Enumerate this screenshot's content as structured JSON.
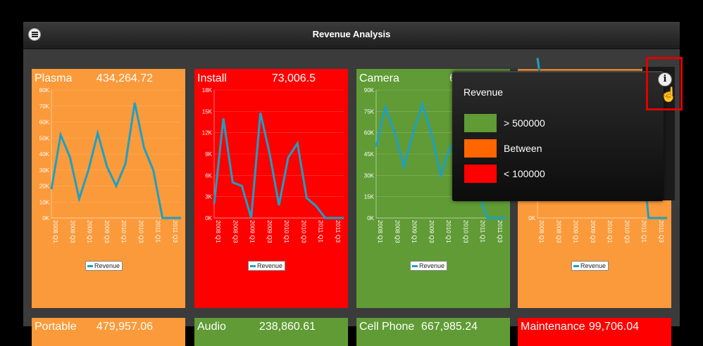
{
  "window": {
    "title": "Revenue Analysis"
  },
  "colors": {
    "green": "#609b35",
    "orange": "#fa9a3a",
    "red": "#fe0000",
    "line": "#1f9fc4",
    "popup_green": "#609b35",
    "popup_orange": "#ff6600",
    "popup_red": "#ff0000"
  },
  "tiles": [
    {
      "name": "Plasma",
      "value": "434,264.72",
      "color": "#fa9a3a",
      "chart_data": {
        "type": "line",
        "series": [
          {
            "name": "Revenue",
            "values": [
              18000,
              52000,
              38000,
              12000,
              30000,
              53000,
              32000,
              20000,
              34000,
              72000,
              44000,
              30000,
              0,
              0,
              0
            ]
          }
        ],
        "yticks": [
          "0K",
          "10K",
          "20K",
          "30K",
          "40K",
          "50K",
          "60K",
          "70K",
          "80K"
        ],
        "ymax": 80000
      }
    },
    {
      "name": "Install",
      "value": "73,006.5",
      "color": "#fe0000",
      "chart_data": {
        "type": "line",
        "series": [
          {
            "name": "Revenue",
            "values": [
              2000,
              14000,
              5000,
              4500,
              0,
              14800,
              9000,
              1800,
              8500,
              10500,
              2800,
              1700,
              0,
              0,
              0
            ]
          }
        ],
        "yticks": [
          "0K",
          "3K",
          "6K",
          "9K",
          "12K",
          "15K",
          "18K"
        ],
        "ymax": 18000
      }
    },
    {
      "name": "Camera",
      "value": "615,7",
      "color": "#609b35",
      "chart_data": {
        "type": "line",
        "series": [
          {
            "name": "Revenue",
            "values": [
              50000,
              78000,
              60000,
              36000,
              60000,
              80000,
              58000,
              30000,
              50000,
              52000,
              36000,
              20000,
              0,
              0,
              0
            ]
          }
        ],
        "yticks": [
          "0K",
          "15K",
          "30K",
          "45K",
          "60K",
          "75K",
          "90K"
        ],
        "ymax": 90000
      }
    },
    {
      "name": "",
      "value": "",
      "color": "#fa9a3a",
      "chart_data": {
        "type": "line",
        "series": [
          {
            "name": "Revenue",
            "values": [
              50000,
              30000,
              8000,
              20000,
              14000,
              18000,
              9000,
              20000,
              18000,
              16000,
              22000,
              30000,
              0,
              0,
              0
            ]
          }
        ],
        "yticks": [
          "0K",
          "10K"
        ],
        "ymax": 40000
      }
    }
  ],
  "xticks": [
    "2008 Q1",
    "2008 Q3",
    "2009 Q1",
    "2009 Q3",
    "2010 Q1",
    "2010 Q3",
    "2011 Q1",
    "2011 Q3"
  ],
  "legend_label": "Revenue",
  "bottom_tiles": [
    {
      "name": "Portable",
      "value": "479,957.06",
      "color": "#fa9a3a"
    },
    {
      "name": "Audio",
      "value": "238,860.61",
      "color": "#609b35"
    },
    {
      "name": "Cell Phone",
      "value": "667,985.24",
      "color": "#609b35"
    },
    {
      "name": "Maintenance",
      "value": "99,706.04",
      "color": "#fe0000"
    }
  ],
  "popup": {
    "title": "Revenue",
    "items": [
      {
        "label": "> 500000",
        "color": "#609b35"
      },
      {
        "label": "Between",
        "color": "#ff6600"
      },
      {
        "label": "< 100000",
        "color": "#ff0000"
      }
    ]
  },
  "icons": {
    "menu": "menu-icon",
    "info": "info-icon",
    "cursor": "hand-cursor-icon"
  },
  "info_glyph": "i",
  "cursor_glyph": "☝"
}
